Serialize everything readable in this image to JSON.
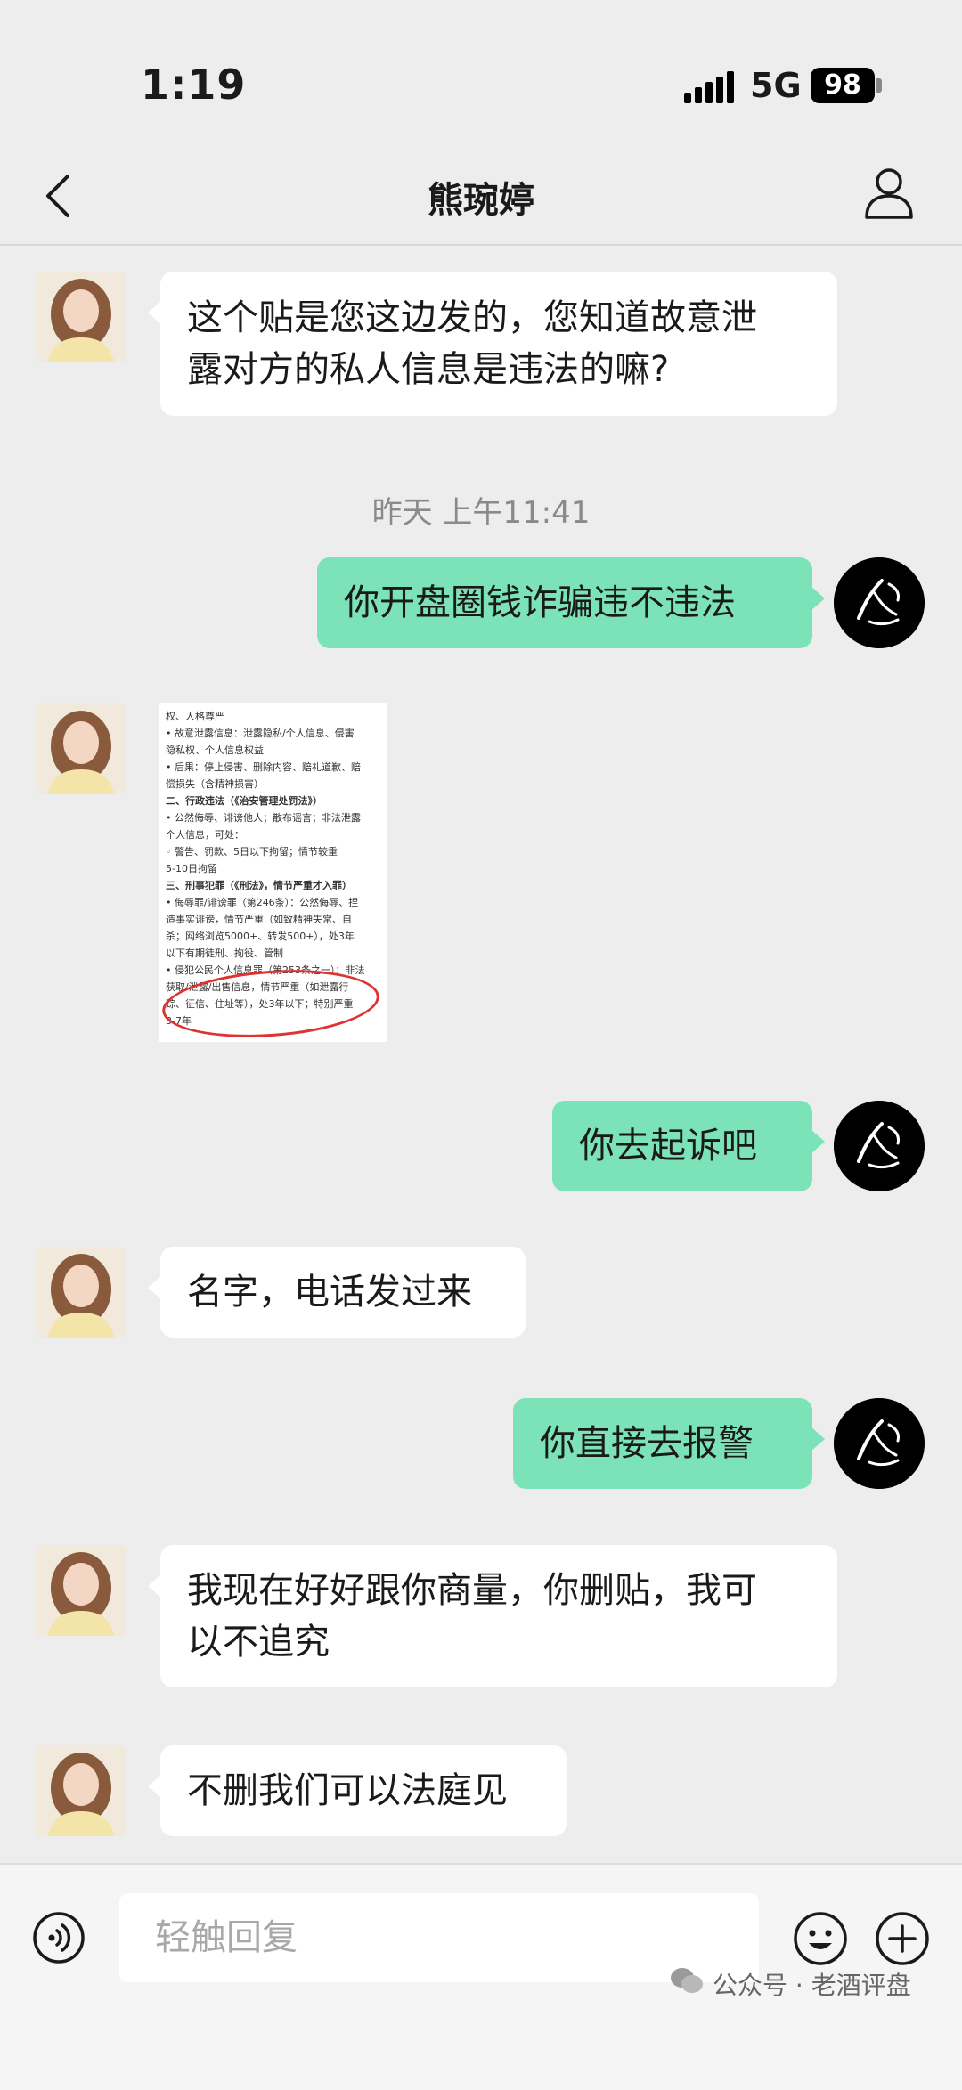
{
  "status": {
    "time": "1:19",
    "network": "5G",
    "battery": "98"
  },
  "header": {
    "title": "熊琬婷"
  },
  "timestamp": "昨天 上午11:41",
  "messages": [
    {
      "side": "left",
      "lines": [
        "这个贴是您这边发的，您知道故意泄",
        "露对方的私人信息是违法的嘛?"
      ]
    },
    {
      "side": "right",
      "text": "你开盘圈钱诈骗违不违法"
    },
    {
      "side": "right",
      "text": "你去起诉吧"
    },
    {
      "side": "left",
      "text": "名字，电话发过来"
    },
    {
      "side": "right",
      "text": "你直接去报警"
    },
    {
      "side": "left",
      "lines": [
        "我现在好好跟你商量，你删贴，我可",
        "以不追究"
      ]
    },
    {
      "side": "left",
      "text": "不删我们可以法庭见"
    }
  ],
  "image_doc": {
    "lines": [
      "权、人格尊严",
      "• 故意泄露信息：泄露隐私/个人信息、侵害",
      "  隐私权、个人信息权益",
      "• 后果：停止侵害、删除内容、赔礼道歉、赔",
      "  偿损失（含精神损害）",
      "二、行政违法（《治安管理处罚法》）",
      "• 公然侮辱、诽谤他人；散布谣言；非法泄露",
      "  个人信息，可处：",
      "  ◦ 警告、罚款、5日以下拘留；情节较重",
      "    5-10日拘留",
      "三、刑事犯罪（《刑法》，情节严重才入罪）",
      "• 侮辱罪/诽谤罪（第246条）：公然侮辱、捏",
      "  造事实诽谤，情节严重（如致精神失常、自",
      "  杀；网络浏览5000+、转发500+），处3年",
      "  以下有期徒刑、拘役、管制",
      "• 侵犯公民个人信息罪（第253条之一）：非法",
      "  获取/泄露/出售信息，情节严重（如泄露行",
      "  踪、征信、住址等），处3年以下；特别严重",
      "  3-7年"
    ]
  },
  "input": {
    "placeholder": "轻触回复"
  },
  "watermark": "公众号 · 老酒评盘"
}
